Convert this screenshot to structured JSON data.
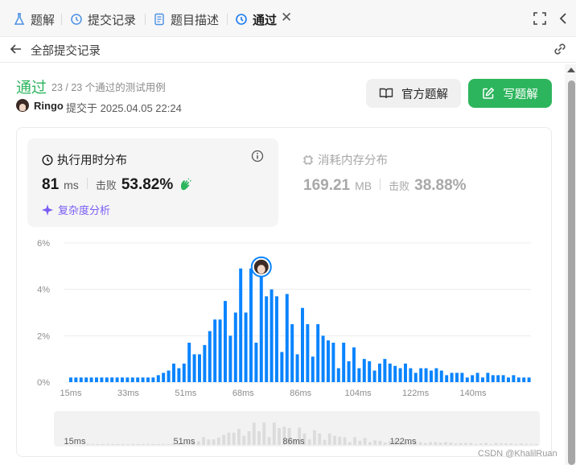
{
  "tabs": [
    {
      "label": "题解",
      "icon": "flask-icon"
    },
    {
      "label": "提交记录",
      "icon": "history-icon"
    },
    {
      "label": "题目描述",
      "icon": "document-icon"
    },
    {
      "label": "通过",
      "icon": "history-icon"
    }
  ],
  "header": {
    "back_label": "全部提交记录"
  },
  "result": {
    "status": "通过",
    "testcases": "23 / 23 个通过的测试用例",
    "username": "Ringo",
    "submitted": "提交于 2025.04.05 22:24"
  },
  "buttons": {
    "official": "官方题解",
    "write": "写题解"
  },
  "runtime": {
    "title": "执行用时分布",
    "value": "81",
    "unit": "ms",
    "beat_label": "击败",
    "beat": "53.82%",
    "complexity": "复杂度分析"
  },
  "memory": {
    "title": "消耗内存分布",
    "value": "169.21",
    "unit": "MB",
    "beat_label": "击败",
    "beat": "38.88%"
  },
  "colors": {
    "accent_green": "#2db55d",
    "bar_blue": "#0a84ff",
    "purple": "#7a5cf5"
  },
  "chart_data": {
    "type": "bar",
    "ylabel": "",
    "xlabel": "",
    "yticks": [
      "0%",
      "2%",
      "4%",
      "6%"
    ],
    "ylim": [
      0,
      6
    ],
    "xticks": [
      "15ms",
      "33ms",
      "51ms",
      "68ms",
      "86ms",
      "104ms",
      "122ms",
      "140ms"
    ],
    "values": [
      0.2,
      0.2,
      0.2,
      0.2,
      0.2,
      0.2,
      0.2,
      0.2,
      0.2,
      0.2,
      0.2,
      0.2,
      0.2,
      0.2,
      0.2,
      0.2,
      0.2,
      0.3,
      0.4,
      0.5,
      0.8,
      0.6,
      0.8,
      1.7,
      1.2,
      1.2,
      1.6,
      2.2,
      2.7,
      2.7,
      3.5,
      2.0,
      3.0,
      4.9,
      3.0,
      4.9,
      1.7,
      4.9,
      3.7,
      4.0,
      3.7,
      1.3,
      3.8,
      2.5,
      1.2,
      3.2,
      2.5,
      1.1,
      2.5,
      2.0,
      1.8,
      1.7,
      0.6,
      1.7,
      0.9,
      1.5,
      0.6,
      1.0,
      0.9,
      0.5,
      0.8,
      1.0,
      0.8,
      0.7,
      0.6,
      0.8,
      0.6,
      0.4,
      0.6,
      0.6,
      0.5,
      0.6,
      0.5,
      0.3,
      0.4,
      0.4,
      0.4,
      0.2,
      0.3,
      0.4,
      0.2,
      0.4,
      0.3,
      0.3,
      0.3,
      0.2,
      0.3,
      0.2,
      0.2,
      0.2
    ],
    "highlight_index": 37,
    "mini_xticks": [
      "15ms",
      "51ms",
      "86ms",
      "122ms"
    ]
  },
  "watermark": "CSDN @KhalilRuan"
}
